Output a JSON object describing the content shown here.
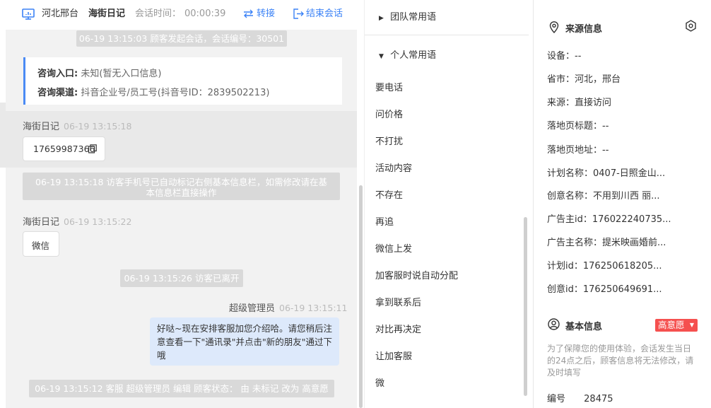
{
  "header": {
    "region": "河北邢台",
    "visitor_name": "海街日记",
    "session_time_label": "会话时间：",
    "session_time": "00:00:39",
    "transfer_label": "转接",
    "end_label": "结束会话"
  },
  "chat": {
    "system_start": "06-19 13:15:03 顾客发起会话，会话编号：30501",
    "entry_label": "咨询入口:",
    "entry_value": "未知(暂无入口信息)",
    "channel_label": "咨询渠道:",
    "channel_value": "抖音企业号/员工号(抖音号ID：2839502213)",
    "msg1_sender": "海街日记",
    "msg1_time": "06-19 13:15:18",
    "msg1_text": "17659987366",
    "system_phone": "06-19 13:15:18 访客手机号已自动标记右侧基本信息栏，如需修改请在基本信息栏直接操作",
    "msg2_sender": "海街日记",
    "msg2_time": "06-19 13:15:22",
    "msg2_text": "微信",
    "system_leave": "06-19 13:15:26 访客已离开",
    "reply_sender": "超级管理员",
    "reply_time": "06-19 13:15:11",
    "reply_text": "好哒~现在安排客服加您介绍哈。请您稍后注意查看一下\"通讯录\"并点击\"新的朋友\"通过下哦",
    "system_status": "06-19 13:15:12 客服 超级管理员 编辑 顾客状态： 由 未标记 改为 高意愿"
  },
  "phrases": {
    "team_label": "团队常用语",
    "personal_label": "个人常用语",
    "items": [
      "要电话",
      "问价格",
      "不打扰",
      "活动内容",
      "不存在",
      "再追",
      "微信上发",
      "加客服时说自动分配",
      "拿到联系后",
      "对比再决定",
      "让加客服",
      "微"
    ]
  },
  "info": {
    "source_title": "来源信息",
    "fields": [
      {
        "label": "设备：",
        "value": "--"
      },
      {
        "label": "省市：",
        "value": "河北，邢台"
      },
      {
        "label": "来源：",
        "value": "直接访问"
      },
      {
        "label": "落地页标题：",
        "value": "--"
      },
      {
        "label": "落地页地址：",
        "value": "--"
      },
      {
        "label": "计划名称：",
        "value": "0407-日照金山..."
      },
      {
        "label": "创意名称：",
        "value": "不用到川西 丽..."
      },
      {
        "label": "广告主id：",
        "value": "176022240735..."
      },
      {
        "label": "广告主名称：",
        "value": "提米映画婚前..."
      },
      {
        "label": "计划id：",
        "value": "176250618205..."
      },
      {
        "label": "创意id：",
        "value": "176250649691..."
      }
    ],
    "basic_title": "基本信息",
    "intent_badge": "高意愿",
    "notice": "为了保障您的使用体验，会话发生当日的24点之后，顾客信息将无法修改，请及时填写",
    "id_label": "编号",
    "id_value": "28475"
  },
  "colors": {
    "accent_blue": "#3b82f6",
    "intent_red": "#f5504f",
    "reply_bubble": "#dde9fb"
  }
}
